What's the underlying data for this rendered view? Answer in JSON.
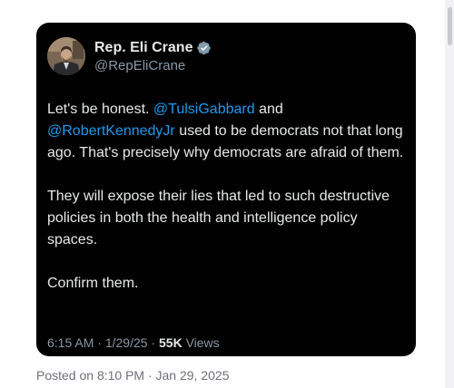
{
  "tweet": {
    "author_name": "Rep. Eli Crane",
    "author_handle": "@RepEliCrane",
    "paragraph1": {
      "pre": "Let's be honest. ",
      "mention1": "@TulsiGabbard",
      "mid": " and ",
      "mention2": "@RobertKennedyJr",
      "post": " used to be democrats not that long ago. That's precisely why democrats are afraid of them."
    },
    "paragraph2": "They will expose their lies that led to such destructive policies in both the health and intelligence policy spaces.",
    "paragraph3": "Confirm them.",
    "time": "6:15 AM",
    "separator": " · ",
    "date": "1/29/25",
    "views_count": "55K",
    "views_label": " Views"
  },
  "posted_on": "Posted on 8:10 PM · Jan 29, 2025",
  "colors": {
    "card_background": "#000000",
    "mention": "#1d9bf0",
    "text": "#e7e9ea",
    "muted": "#8b98a5",
    "verified_badge": "#829aab"
  },
  "icons": {
    "verified": "verified-badge-icon"
  }
}
